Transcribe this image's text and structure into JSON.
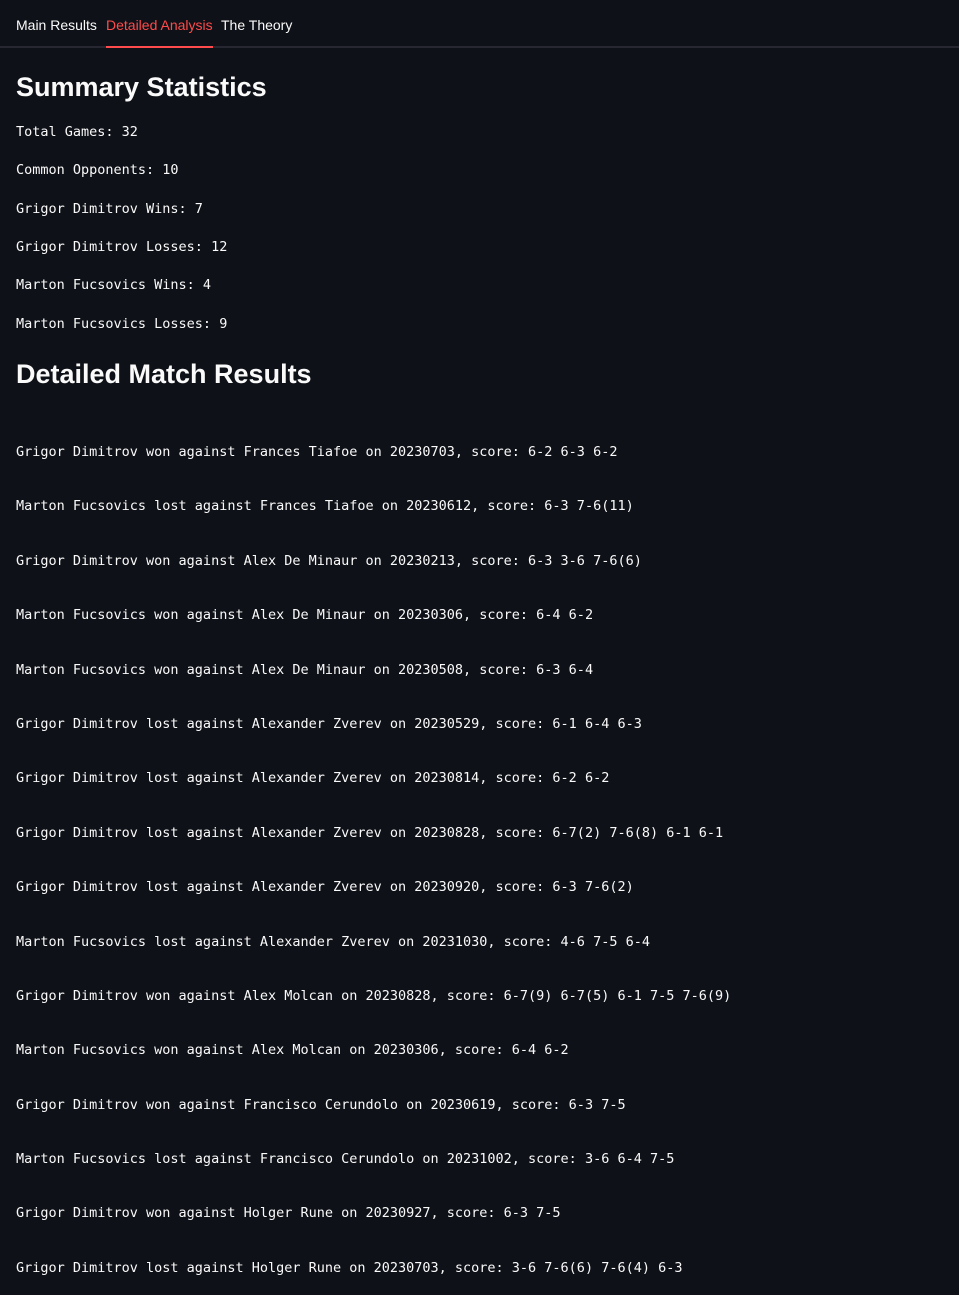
{
  "tabs": [
    {
      "label": "Main Results",
      "active": false
    },
    {
      "label": "Detailed Analysis",
      "active": true
    },
    {
      "label": "The Theory",
      "active": false
    }
  ],
  "colors": {
    "background": "#0e1117",
    "text": "#fafafa",
    "accent": "#ff4b4b",
    "divider": "#262730"
  },
  "summary": {
    "title": "Summary Statistics",
    "lines": [
      "Total Games: 32",
      "Common Opponents: 10",
      "Grigor Dimitrov Wins: 7",
      "Grigor Dimitrov Losses: 12",
      "Marton Fucsovics Wins: 4",
      "Marton Fucsovics Losses: 9"
    ]
  },
  "details": {
    "title": "Detailed Match Results",
    "matches": [
      "Grigor Dimitrov won against Frances Tiafoe on 20230703, score: 6-2 6-3 6-2",
      "Marton Fucsovics lost against Frances Tiafoe on 20230612, score: 6-3 7-6(11)",
      "Grigor Dimitrov won against Alex De Minaur on 20230213, score: 6-3 3-6 7-6(6)",
      "Marton Fucsovics won against Alex De Minaur on 20230306, score: 6-4 6-2",
      "Marton Fucsovics won against Alex De Minaur on 20230508, score: 6-3 6-4",
      "Grigor Dimitrov lost against Alexander Zverev on 20230529, score: 6-1 6-4 6-3",
      "Grigor Dimitrov lost against Alexander Zverev on 20230814, score: 6-2 6-2",
      "Grigor Dimitrov lost against Alexander Zverev on 20230828, score: 6-7(2) 7-6(8) 6-1 6-1",
      "Grigor Dimitrov lost against Alexander Zverev on 20230920, score: 6-3 7-6(2)",
      "Marton Fucsovics lost against Alexander Zverev on 20231030, score: 4-6 7-5 6-4",
      "Grigor Dimitrov won against Alex Molcan on 20230828, score: 6-7(9) 6-7(5) 6-1 7-5 7-6(9)",
      "Marton Fucsovics won against Alex Molcan on 20230306, score: 6-4 6-2",
      "Grigor Dimitrov won against Francisco Cerundolo on 20230619, score: 6-3 7-5",
      "Marton Fucsovics lost against Francisco Cerundolo on 20231002, score: 3-6 6-4 7-5",
      "Grigor Dimitrov won against Holger Rune on 20230927, score: 6-3 7-5",
      "Grigor Dimitrov lost against Holger Rune on 20230703, score: 3-6 7-6(6) 7-6(4) 6-3"
    ]
  }
}
